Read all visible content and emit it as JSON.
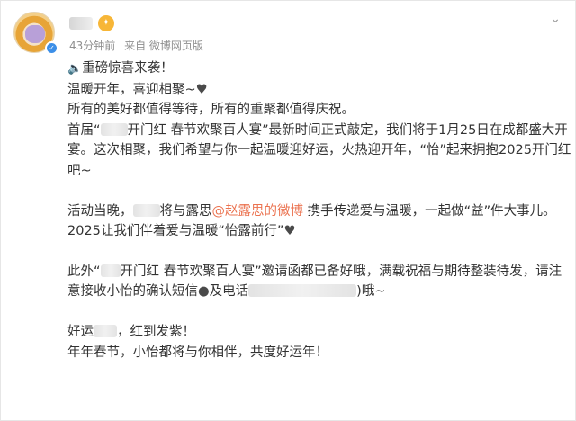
{
  "post": {
    "time": "43分钟前",
    "source": "来自 微博网页版",
    "verified_mark": "✓",
    "more_icon": "⌄"
  },
  "lines": {
    "l1": "重磅惊喜来袭！",
    "l2": "温暖开年，喜迎相聚~",
    "l3": "所有的美好都值得等待，所有的重聚都值得庆祝。",
    "l4a": "首届“",
    "l4b": "开门红 春节欢聚百人宴”最新时间正式敲定，我们将于1月25日在成都盛大开",
    "l5": "宴。这次相聚，我们希望与你一起温暖迎好运，火热迎开年，“怡”起来拥抱2025开门红",
    "l6": "吧~",
    "l7a": "活动当晚，",
    "l7b": "将与露思",
    "l7link": "@赵露思的微博",
    "l7c": " 携手传递爱与温暖，一起做“益”件大事儿。",
    "l8": "2025让我们伴着爱与温暖“怡露前行”",
    "l9a": "此外“",
    "l9b": "开门红 春节欢聚百人宴”邀请函都已备好哦，满载祝福与期待整装待发，请注",
    "l10a": "意接收小怡的确认短信",
    "l10b": "及电话",
    "l10c": ")哦~",
    "l11a": "好运",
    "l11b": "，红到发紫！",
    "l12": "年年春节，小怡都将与你相伴，共度好运年！"
  },
  "icons": {
    "speaker": "🔈",
    "heart": "♥",
    "bubble": "●"
  }
}
